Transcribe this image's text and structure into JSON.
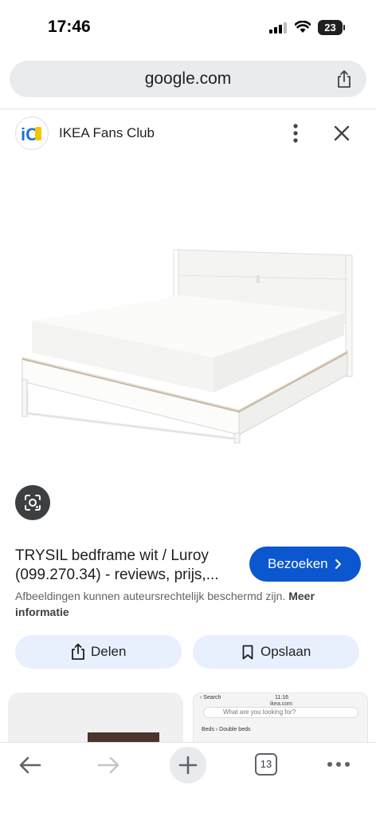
{
  "status_bar": {
    "time": "17:46",
    "battery": "23"
  },
  "browser": {
    "url": "google.com",
    "tab_count": "13"
  },
  "source": {
    "name": "IKEA Fans Club",
    "logo_text": "iC"
  },
  "result": {
    "title_line1": "TRYSIL bedframe wit / Luroy",
    "title_line2": "(099.270.34) - reviews, prijs,...",
    "visit_label": "Bezoeken",
    "copyright_text": "Afbeeldingen kunnen auteursrechtelijk beschermd zijn.",
    "more_info": "Meer informatie",
    "share_label": "Delen",
    "save_label": "Opslaan"
  },
  "related": {
    "right_thumb": {
      "status_left": "‹ Search",
      "time": "11:16",
      "url": "ikea.com",
      "search_placeholder": "What are you looking for?",
      "breadcrumb": "Beds  ›  Double beds"
    }
  },
  "colors": {
    "accent": "#0b57d0",
    "chip": "#e8f0fe",
    "lens": "#3c4043"
  }
}
